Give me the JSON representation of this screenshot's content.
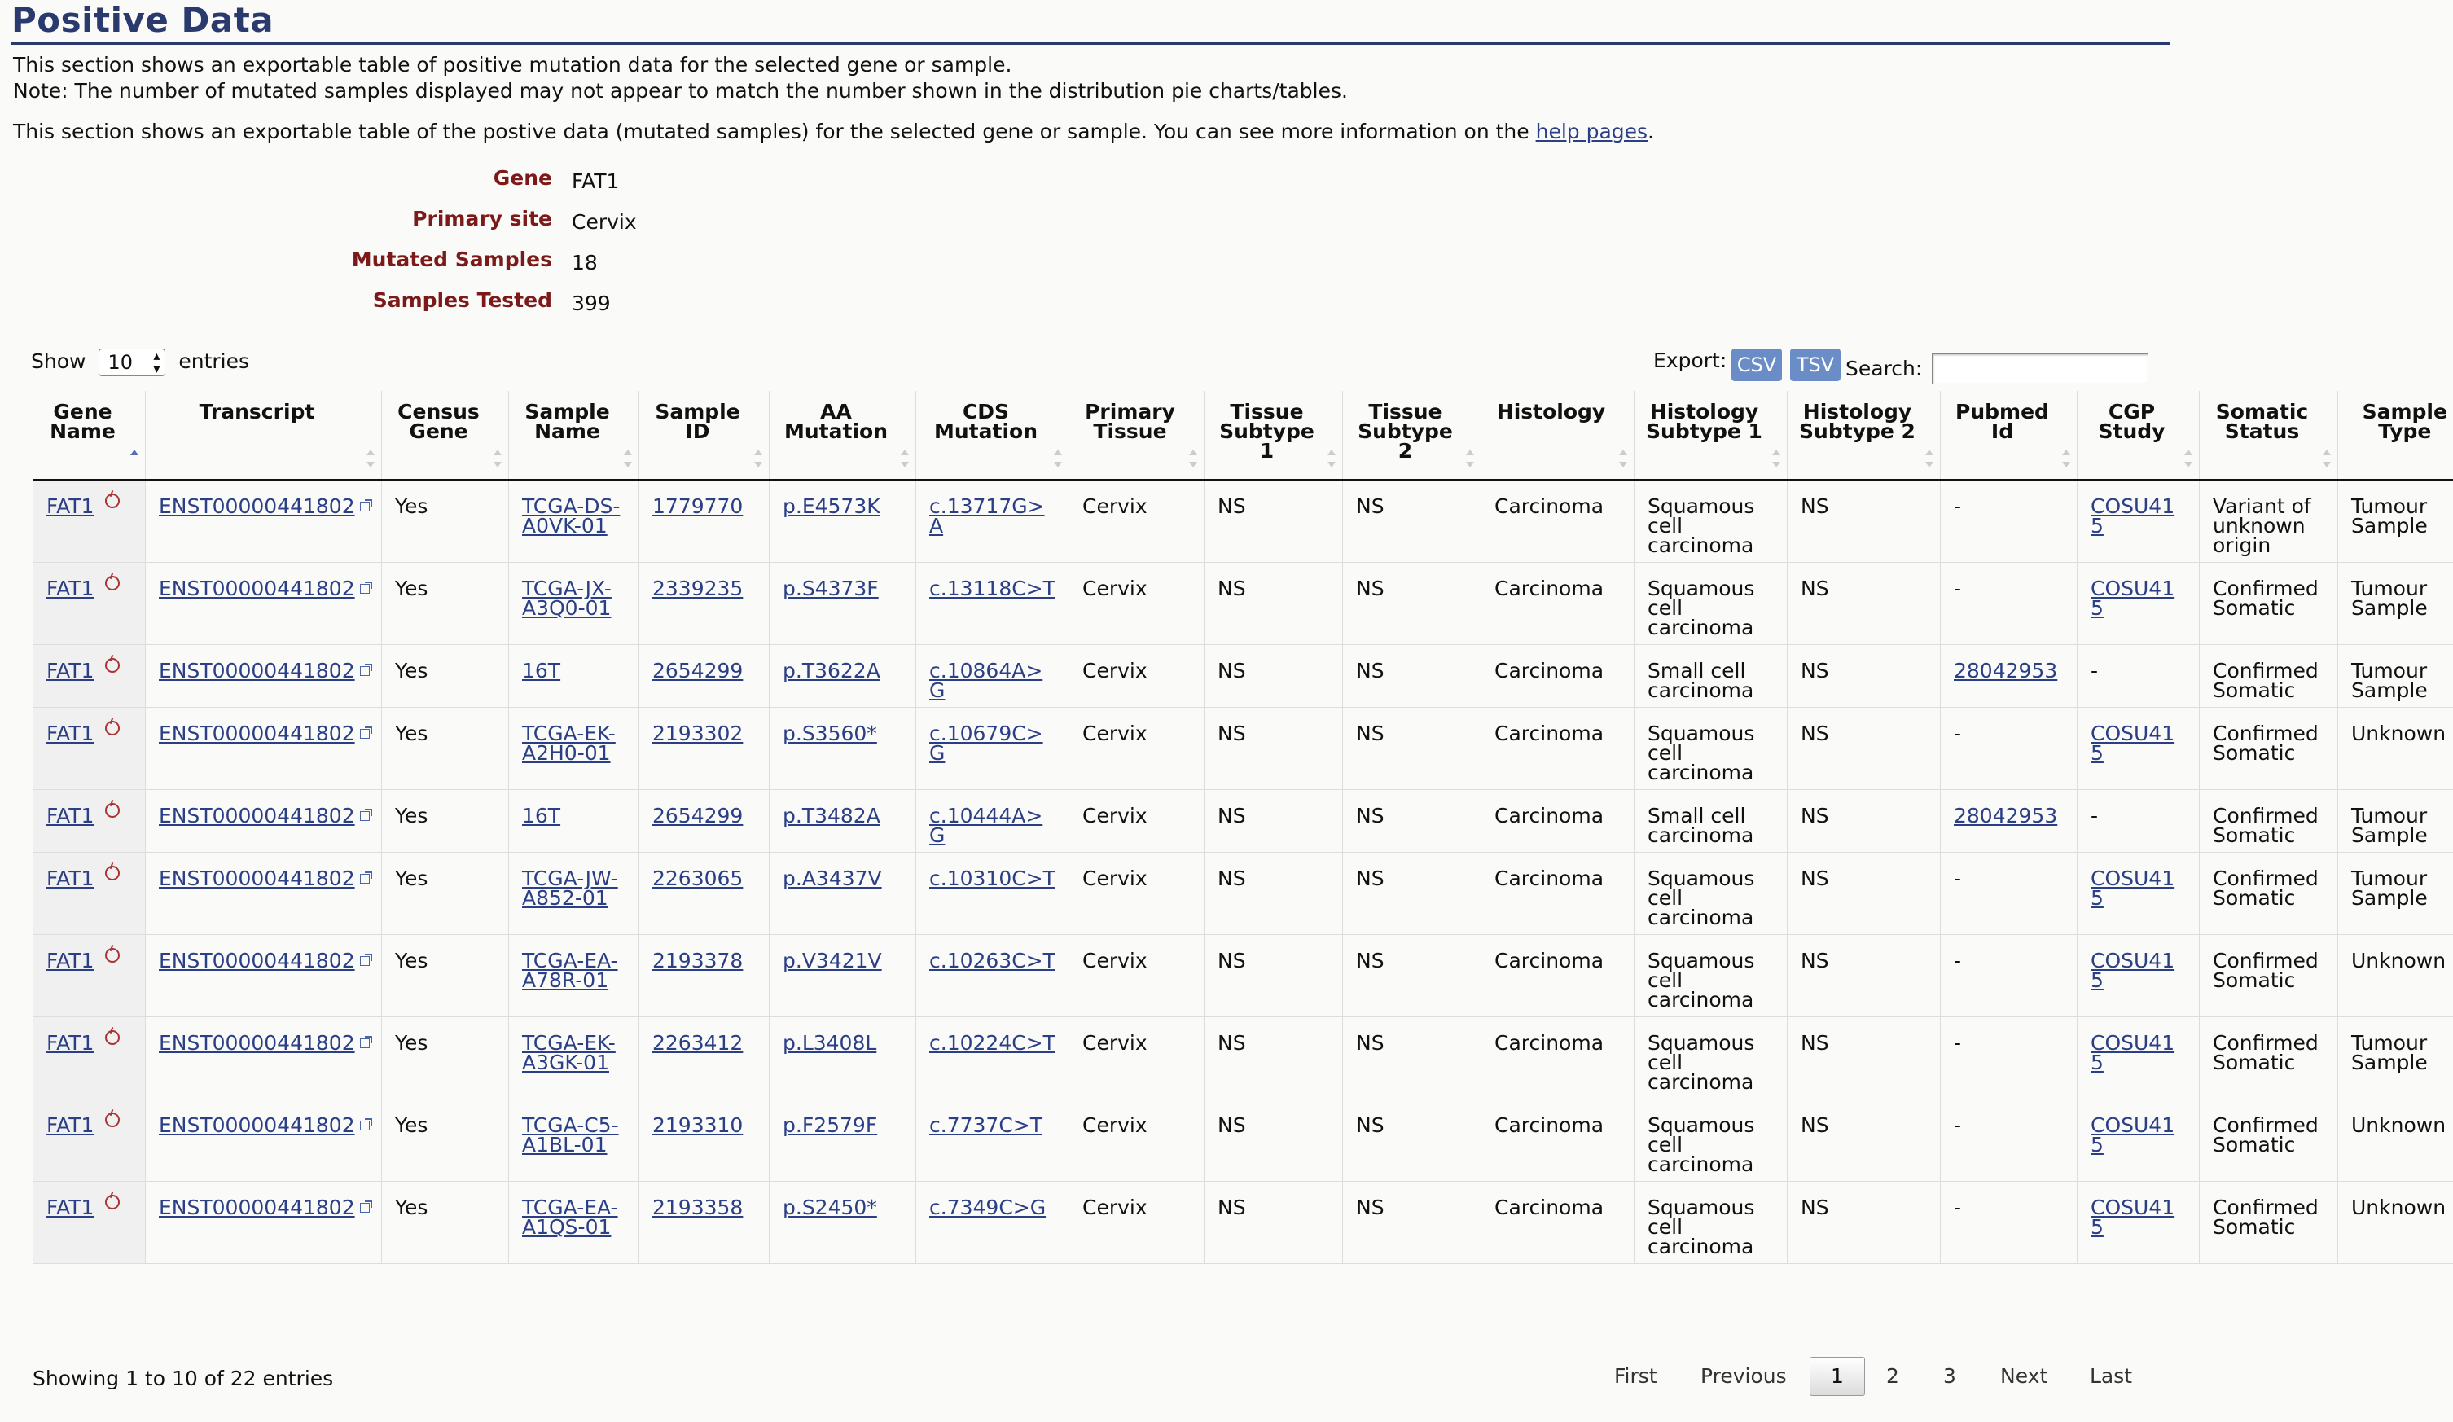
{
  "page": {
    "title": "Positive Data",
    "intro1": "This section shows an exportable table of positive mutation data for the selected gene or sample.",
    "intro2": "Note: The number of mutated samples displayed may not appear to match the number shown in the distribution pie charts/tables.",
    "intro3_prefix": "This section shows an exportable table of the postive data (mutated samples) for the selected gene or sample. You can see more information on the ",
    "intro3_link": "help pages",
    "intro3_suffix": "."
  },
  "summary": {
    "gene_label": "Gene",
    "gene_value": "FAT1",
    "site_label": "Primary site",
    "site_value": "Cervix",
    "mutated_label": "Mutated Samples",
    "mutated_value": "18",
    "tested_label": "Samples Tested",
    "tested_value": "399"
  },
  "controls": {
    "show_label": "Show",
    "entries_value": "10",
    "entries_label": "entries",
    "export_label": "Export:",
    "csv_label": "CSV",
    "tsv_label": "TSV",
    "search_label": "Search:",
    "search_value": ""
  },
  "table": {
    "headers": [
      "Gene Name",
      "Transcript",
      "Census Gene",
      "Sample Name",
      "Sample ID",
      "AA Mutation",
      "CDS Mutation",
      "Primary Tissue",
      "Tissue Subtype 1",
      "Tissue Subtype 2",
      "Histology",
      "Histology Subtype 1",
      "Histology Subtype 2",
      "Pubmed Id",
      "CGP Study",
      "Somatic Status",
      "Sample Type"
    ],
    "rows": [
      [
        "FAT1",
        "ENST00000441802",
        "Yes",
        "TCGA-DS-A0VK-01",
        "1779770",
        "p.E4573K",
        "c.13717G>A",
        "Cervix",
        "NS",
        "NS",
        "Carcinoma",
        "Squamous cell carcinoma",
        "NS",
        "-",
        "COSU415",
        "Variant of unknown origin",
        "Tumour Sample"
      ],
      [
        "FAT1",
        "ENST00000441802",
        "Yes",
        "TCGA-JX-A3Q0-01",
        "2339235",
        "p.S4373F",
        "c.13118C>T",
        "Cervix",
        "NS",
        "NS",
        "Carcinoma",
        "Squamous cell carcinoma",
        "NS",
        "-",
        "COSU415",
        "Confirmed Somatic",
        "Tumour Sample"
      ],
      [
        "FAT1",
        "ENST00000441802",
        "Yes",
        "16T",
        "2654299",
        "p.T3622A",
        "c.10864A>G",
        "Cervix",
        "NS",
        "NS",
        "Carcinoma",
        "Small cell carcinoma",
        "NS",
        "28042953",
        "-",
        "Confirmed Somatic",
        "Tumour Sample"
      ],
      [
        "FAT1",
        "ENST00000441802",
        "Yes",
        "TCGA-EK-A2H0-01",
        "2193302",
        "p.S3560*",
        "c.10679C>G",
        "Cervix",
        "NS",
        "NS",
        "Carcinoma",
        "Squamous cell carcinoma",
        "NS",
        "-",
        "COSU415",
        "Confirmed Somatic",
        "Unknown"
      ],
      [
        "FAT1",
        "ENST00000441802",
        "Yes",
        "16T",
        "2654299",
        "p.T3482A",
        "c.10444A>G",
        "Cervix",
        "NS",
        "NS",
        "Carcinoma",
        "Small cell carcinoma",
        "NS",
        "28042953",
        "-",
        "Confirmed Somatic",
        "Tumour Sample"
      ],
      [
        "FAT1",
        "ENST00000441802",
        "Yes",
        "TCGA-JW-A852-01",
        "2263065",
        "p.A3437V",
        "c.10310C>T",
        "Cervix",
        "NS",
        "NS",
        "Carcinoma",
        "Squamous cell carcinoma",
        "NS",
        "-",
        "COSU415",
        "Confirmed Somatic",
        "Tumour Sample"
      ],
      [
        "FAT1",
        "ENST00000441802",
        "Yes",
        "TCGA-EA-A78R-01",
        "2193378",
        "p.V3421V",
        "c.10263C>T",
        "Cervix",
        "NS",
        "NS",
        "Carcinoma",
        "Squamous cell carcinoma",
        "NS",
        "-",
        "COSU415",
        "Confirmed Somatic",
        "Unknown"
      ],
      [
        "FAT1",
        "ENST00000441802",
        "Yes",
        "TCGA-EK-A3GK-01",
        "2263412",
        "p.L3408L",
        "c.10224C>T",
        "Cervix",
        "NS",
        "NS",
        "Carcinoma",
        "Squamous cell carcinoma",
        "NS",
        "-",
        "COSU415",
        "Confirmed Somatic",
        "Tumour Sample"
      ],
      [
        "FAT1",
        "ENST00000441802",
        "Yes",
        "TCGA-C5-A1BL-01",
        "2193310",
        "p.F2579F",
        "c.7737C>T",
        "Cervix",
        "NS",
        "NS",
        "Carcinoma",
        "Squamous cell carcinoma",
        "NS",
        "-",
        "COSU415",
        "Confirmed Somatic",
        "Unknown"
      ],
      [
        "FAT1",
        "ENST00000441802",
        "Yes",
        "TCGA-EA-A1QS-01",
        "2193358",
        "p.S2450*",
        "c.7349C>G",
        "Cervix",
        "NS",
        "NS",
        "Carcinoma",
        "Squamous cell carcinoma",
        "NS",
        "-",
        "COSU415",
        "Confirmed Somatic",
        "Unknown"
      ]
    ]
  },
  "footer": {
    "info": "Showing 1 to 10 of 22 entries",
    "first": "First",
    "previous": "Previous",
    "pages": [
      "1",
      "2",
      "3"
    ],
    "next": "Next",
    "last": "Last"
  },
  "colors": {
    "title": "#2b3a6c",
    "label": "#7c1a1a",
    "link": "#2b3f86",
    "button": "#6a8cc7"
  }
}
